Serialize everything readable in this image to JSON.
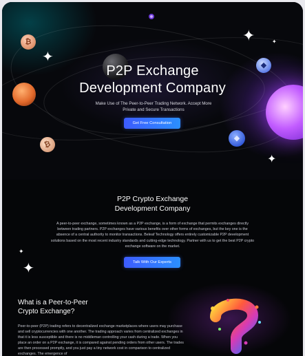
{
  "hero": {
    "title_line1": "P2P Exchange",
    "title_line2": "Development Company",
    "subtitle_line1": "Make Use of The Peer-to-Peer Trading Network. Accept More",
    "subtitle_line2": "Private and Secure Transactions",
    "cta_label": "Get Free Consultation"
  },
  "section_two": {
    "title_line1": "P2P Crypto Exchange",
    "title_line2": "Development Company",
    "body": "A peer-to-peer exchange, sometimes known as a P2P exchange, is a form of exchange that permits exchanges directly between trading partners. P2P exchanges have various benefits over other forms of exchanges, but the key one is the absence of a central authority to monitor transactions. Beleaf Technology offers entirely customizable P2P development solutions based on the most recent industry standards and cutting-edge technology. Partner with us to get the best P2P crypto exchange software on the market.",
    "cta_label": "Talk With Our Experts"
  },
  "section_three": {
    "title_line1": "What is a Peer-to-Peer",
    "title_line2": "Crypto Exchange?",
    "body": "Peer-to-peer (P2P) trading refers to decentralized exchange marketplaces where users may purchase and sell cryptocurrencies with one another. The trading approach varies from centralized exchanges in that it is less susceptible and there is no middleman controlling your cash during a trade. When you place an order on a P2P exchange, it is compared against pending orders from other users. The trades are then processed promptly, and you just pay a tiny network cost in comparison to centralized exchanges. The emergence of"
  },
  "colors": {
    "background": "#050608",
    "button_start": "#3d5cff",
    "button_end": "#2b8fff",
    "purple_orb": "#b04bff",
    "orange_orb": "#e26a2c"
  },
  "icons": {
    "coin_bitcoin": "bitcoin-coin-icon",
    "coin_ethereum": "ethereum-coin-icon",
    "sparkle": "sparkle-icon",
    "question_mark": "colorful-question-mark-icon"
  }
}
